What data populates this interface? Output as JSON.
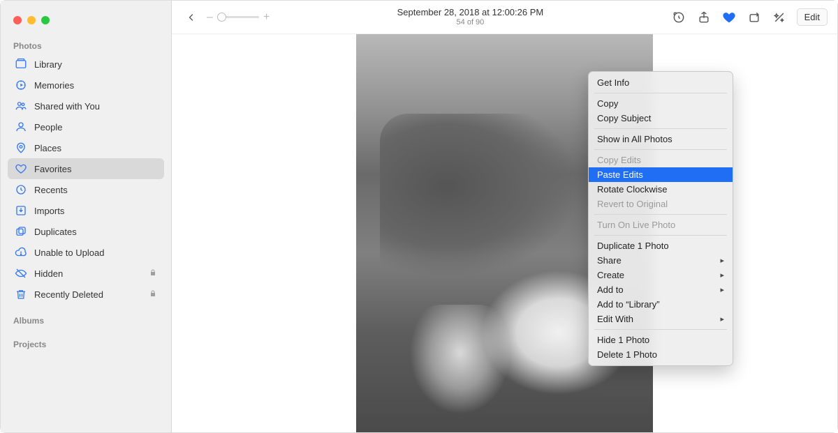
{
  "sidebar": {
    "sections": {
      "photos_label": "Photos",
      "albums_label": "Albums",
      "projects_label": "Projects"
    },
    "items": [
      {
        "label": "Library"
      },
      {
        "label": "Memories"
      },
      {
        "label": "Shared with You"
      },
      {
        "label": "People"
      },
      {
        "label": "Places"
      },
      {
        "label": "Favorites"
      },
      {
        "label": "Recents"
      },
      {
        "label": "Imports"
      },
      {
        "label": "Duplicates"
      },
      {
        "label": "Unable to Upload"
      },
      {
        "label": "Hidden"
      },
      {
        "label": "Recently Deleted"
      }
    ]
  },
  "toolbar": {
    "title": "September 28, 2018 at 12:00:26 PM",
    "subtitle": "54 of 90",
    "zoom_minus": "–",
    "zoom_plus": "+",
    "edit_label": "Edit"
  },
  "context_menu": {
    "get_info": "Get Info",
    "copy": "Copy",
    "copy_subject": "Copy Subject",
    "show_in_all": "Show in All Photos",
    "copy_edits": "Copy Edits",
    "paste_edits": "Paste Edits",
    "rotate_cw": "Rotate Clockwise",
    "revert": "Revert to Original",
    "live_photo": "Turn On Live Photo",
    "duplicate": "Duplicate 1 Photo",
    "share": "Share",
    "create": "Create",
    "add_to": "Add to",
    "add_to_library": "Add to “Library”",
    "edit_with": "Edit With",
    "hide": "Hide 1 Photo",
    "delete": "Delete 1 Photo"
  }
}
